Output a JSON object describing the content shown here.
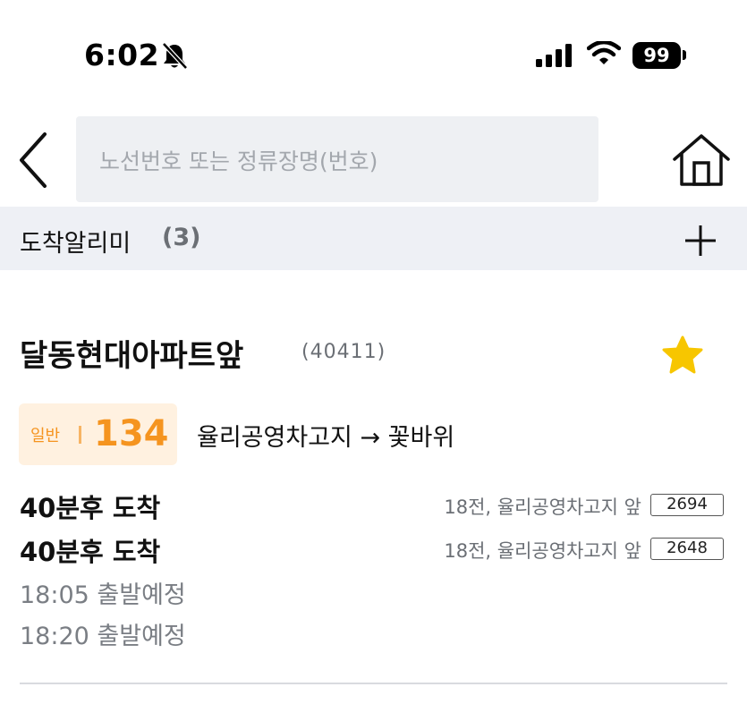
{
  "status_bar": {
    "time": "6:02",
    "battery": "99",
    "icons": [
      "bell-slash-icon",
      "cellular-signal-icon",
      "wifi-icon",
      "battery-icon"
    ]
  },
  "header": {
    "search_placeholder": "노선번호 또는 정류장명(번호)",
    "back_icon": "chevron-left-icon",
    "home_icon": "home-icon"
  },
  "alert_bar": {
    "title": "도착알리미",
    "count": "(3)",
    "add_icon": "plus-icon"
  },
  "stop": {
    "name": "달동현대아파트앞",
    "id": "(40411)",
    "favorite_icon": "star-icon",
    "favorite_color": "#f7c600"
  },
  "route": {
    "type": "일반",
    "number": "134",
    "direction": "율리공영차고지 → 꽃바위",
    "accent_color": "#f5941f",
    "badge_bg": "#fff1e0"
  },
  "arrivals": [
    {
      "text": "40분후 도착",
      "info": "18전, 율리공영차고지 앞",
      "plate": "2694"
    },
    {
      "text": "40분후 도착",
      "info": "18전, 율리공영차고지 앞",
      "plate": "2648"
    }
  ],
  "departures": [
    {
      "text": "18:05 출발예정"
    },
    {
      "text": "18:20 출발예정"
    }
  ]
}
